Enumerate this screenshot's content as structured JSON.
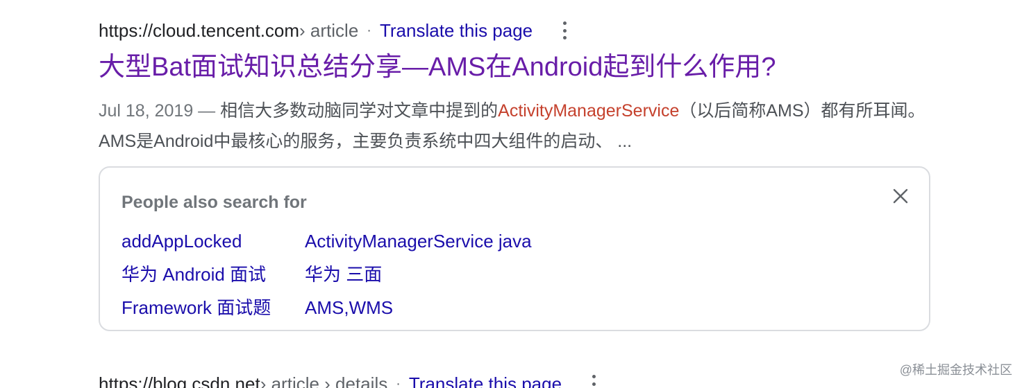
{
  "result1": {
    "url_domain": "https://cloud.tencent.com",
    "url_path": " › article",
    "separator": "·",
    "translate_label": "Translate this page",
    "title": "大型Bat面试知识总结分享—AMS在Android起到什么作用?",
    "snippet_date": "Jul 18, 2019 — ",
    "snippet_before": "相信大多数动脑同学对文章中提到的",
    "snippet_highlight": "ActivityManagerService",
    "snippet_after": "（以后简称AMS）都有所耳闻。 AMS是Android中最核心的服务，主要负责系统中四大组件的启动、 ..."
  },
  "pasf": {
    "title": "People also search for",
    "links": [
      "addAppLocked",
      "ActivityManagerService java",
      "华为 Android 面试",
      "华为 三面",
      "Framework 面试题",
      "AMS,WMS"
    ]
  },
  "result2": {
    "url_domain": "https://blog.csdn.net",
    "url_path": " › article › details",
    "separator": "·",
    "translate_label": "Translate this page"
  },
  "watermark": "@稀土掘金技术社区",
  "colors": {
    "link": "#1a0dab",
    "visited_title": "#681da8",
    "highlight": "#c5412d",
    "snippet": "#4d5156",
    "border": "#dadce0"
  },
  "icons": {
    "more": "more-vert-icon",
    "close": "close-icon"
  }
}
